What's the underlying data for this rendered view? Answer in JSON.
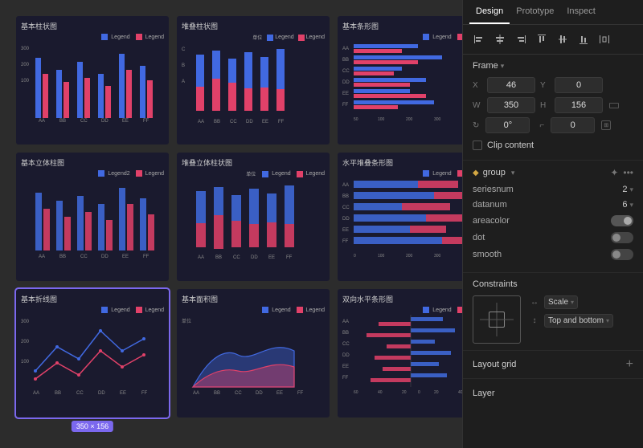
{
  "tabs": {
    "design": "Design",
    "prototype": "Prototype",
    "inspect": "Inspect"
  },
  "panel": {
    "frame_title": "Frame",
    "x_label": "X",
    "x_value": "46",
    "y_label": "Y",
    "y_value": "0",
    "w_label": "W",
    "w_value": "350",
    "h_label": "H",
    "h_value": "156",
    "rotation_label": "0°",
    "corner_label": "0",
    "clip_content": "Clip content",
    "group_name": "group",
    "seriesnum_label": "seriesnum",
    "seriesnum_value": "2",
    "datanum_label": "datanum",
    "datanum_value": "6",
    "areacolor_label": "areacolor",
    "dot_label": "dot",
    "smooth_label": "smooth",
    "constraints_title": "Constraints",
    "scale_label": "Scale",
    "top_bottom_label": "Top and bottom",
    "layout_grid_label": "Layout grid",
    "layer_label": "Layer"
  },
  "charts": [
    {
      "title": "基本柱状图",
      "type": "bar"
    },
    {
      "title": "堆叠柱状图",
      "type": "stacked-bar"
    },
    {
      "title": "基本条形图",
      "type": "horizontal-bar"
    },
    {
      "title": "基本立体柱图",
      "type": "3d-bar"
    },
    {
      "title": "堆叠立体柱状图",
      "type": "stacked-3d"
    },
    {
      "title": "水平堆叠条形图",
      "type": "h-stacked"
    },
    {
      "title": "基本折线图",
      "type": "line",
      "selected": true
    },
    {
      "title": "基本面积图",
      "type": "area"
    },
    {
      "title": "双向水平条形图",
      "type": "bidirectional"
    }
  ],
  "size_badge": "350 × 156",
  "align_icons": [
    "⊣",
    "⊥",
    "⊢",
    "⊤",
    "⊞",
    "⊟",
    "|||"
  ],
  "legend": [
    "Legend",
    "Legend"
  ]
}
